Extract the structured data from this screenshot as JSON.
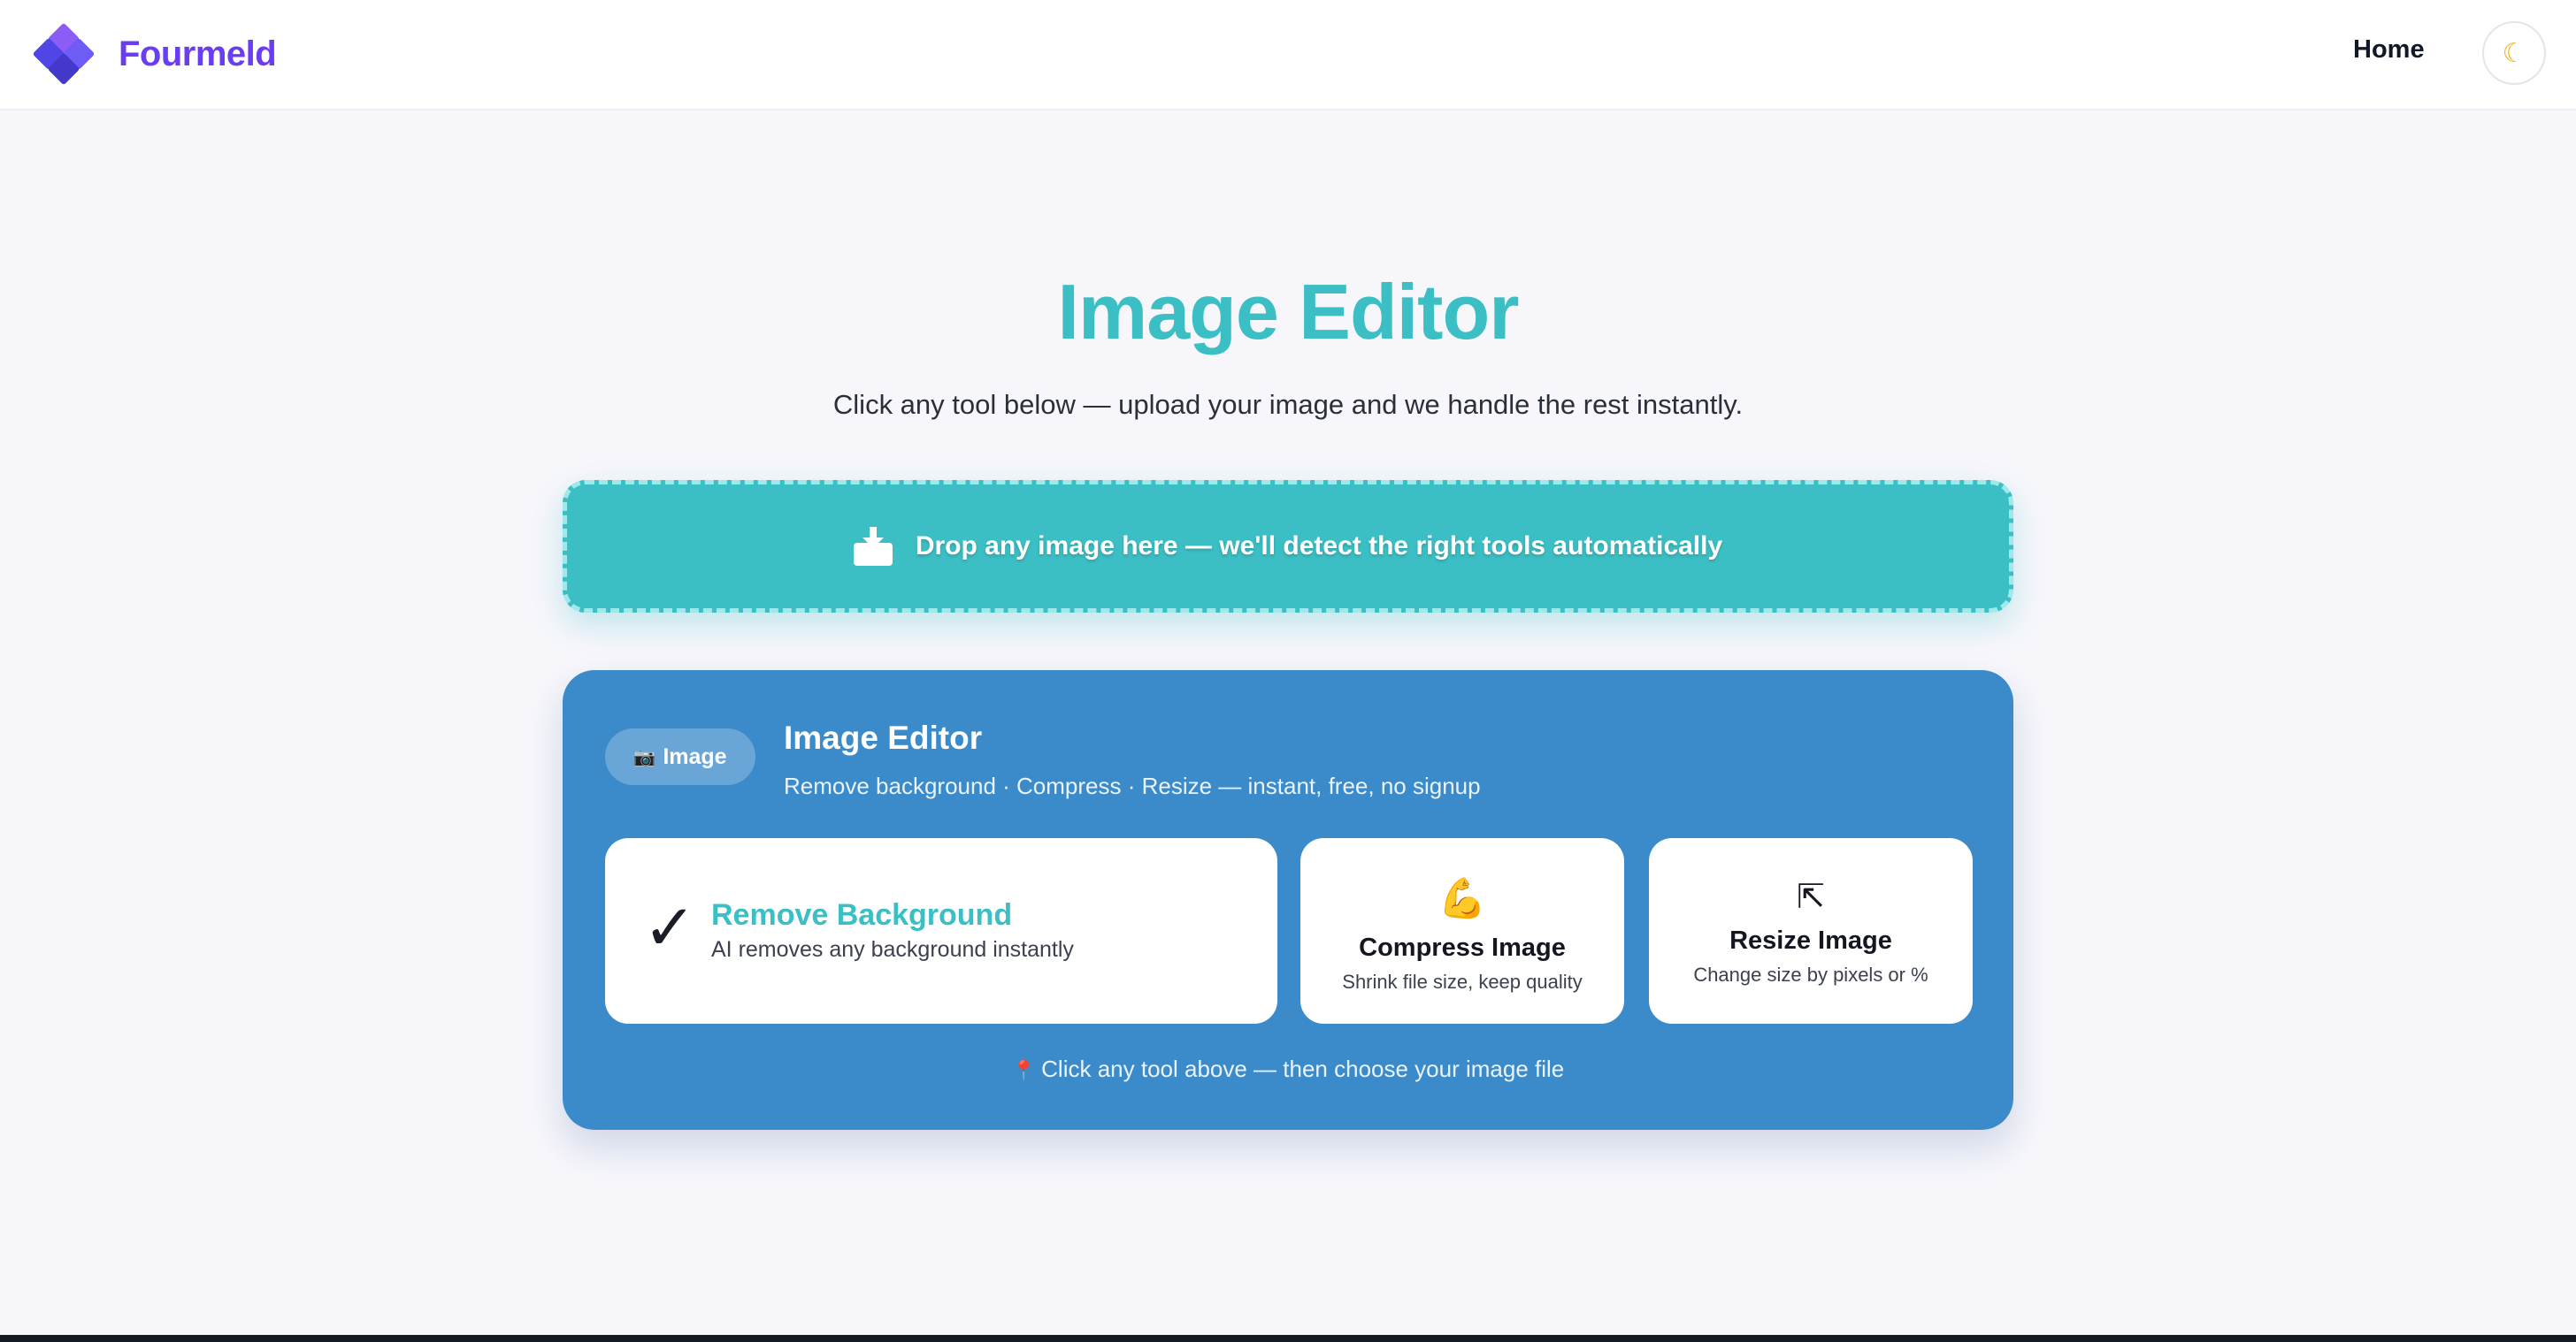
{
  "header": {
    "brand_name": "Fourmeld",
    "nav_home": "Home",
    "theme_toggle_icon": "moon-icon",
    "theme_toggle_glyph": "☾"
  },
  "hero": {
    "title": "Image Editor",
    "subtitle": "Click any tool below — upload your image and we handle the rest instantly."
  },
  "dropzone": {
    "icon": "inbox-tray-icon",
    "text": "Drop any image here — we'll detect the right tools automatically"
  },
  "editor": {
    "badge_icon": "camera-icon",
    "badge_glyph": "📷",
    "badge_label": "Image",
    "title": "Image Editor",
    "subtitle": "Remove background · Compress · Resize — instant, free, no signup",
    "tools": [
      {
        "icon": "check-mark-icon",
        "glyph": "✓",
        "title": "Remove Background",
        "description": "AI removes any background instantly"
      },
      {
        "icon": "flexed-biceps-icon",
        "glyph": "💪",
        "title": "Compress Image",
        "description": "Shrink file size, keep quality"
      },
      {
        "icon": "resize-arrow-icon",
        "glyph": "⇱",
        "title": "Resize Image",
        "description": "Change size by pixels or %"
      }
    ],
    "footer_icon": "pin-icon",
    "footer_glyph": "📍",
    "footer_text": "Click any tool above — then choose your image file"
  },
  "colors": {
    "brand": "#6b3df2",
    "accent_teal": "#3bbfc4",
    "card_blue": "#3b8bcb",
    "background": "#f6f6fb"
  }
}
